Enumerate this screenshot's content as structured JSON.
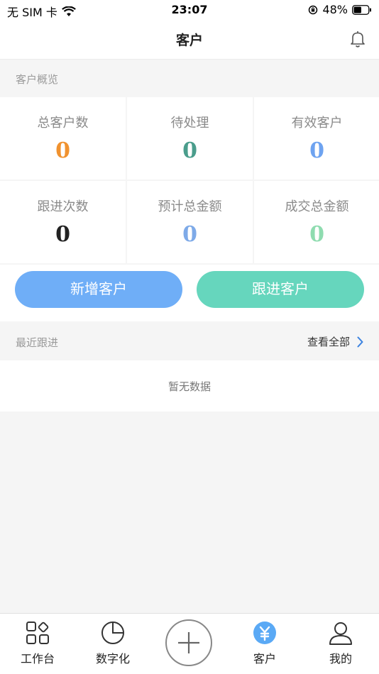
{
  "status_bar": {
    "carrier": "无 SIM 卡",
    "time": "23:07",
    "battery": "48%"
  },
  "nav": {
    "title": "客户"
  },
  "overview": {
    "title": "客户概览",
    "stats": [
      {
        "label": "总客户数",
        "value": "0",
        "color": "#f0922f"
      },
      {
        "label": "待处理",
        "value": "0",
        "color": "#4a9d8c"
      },
      {
        "label": "有效客户",
        "value": "0",
        "color": "#6ea3f0"
      },
      {
        "label": "跟进次数",
        "value": "0",
        "color": "#222222"
      },
      {
        "label": "预计总金额",
        "value": "0",
        "color": "#7eaae8"
      },
      {
        "label": "成交总金额",
        "value": "0",
        "color": "#8fdcb0"
      }
    ]
  },
  "actions": {
    "add_label": "新增客户",
    "follow_label": "跟进客户"
  },
  "recent": {
    "title": "最近跟进",
    "see_all": "查看全部",
    "empty": "暂无数据"
  },
  "tabs": [
    {
      "label": "工作台",
      "icon": "grid-icon"
    },
    {
      "label": "数字化",
      "icon": "pie-icon"
    },
    {
      "label": "",
      "icon": "plus-icon"
    },
    {
      "label": "客户",
      "icon": "yuan-icon",
      "active_color": "#5aa9f5"
    },
    {
      "label": "我的",
      "icon": "user-icon"
    }
  ]
}
